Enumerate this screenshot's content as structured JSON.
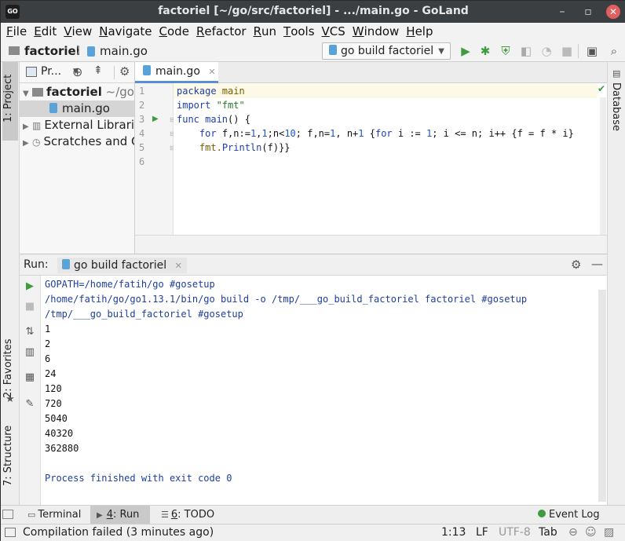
{
  "window": {
    "title": "factoriel [~/go/src/factoriel] - .../main.go - GoLand",
    "app_icon_text": "GO",
    "minimize_glyph": "–",
    "maximize_glyph": "▫",
    "close_glyph": "✕"
  },
  "menu": [
    {
      "mn": "F",
      "rest": "ile"
    },
    {
      "mn": "E",
      "rest": "dit"
    },
    {
      "mn": "V",
      "rest": "iew"
    },
    {
      "mn": "N",
      "rest": "avigate"
    },
    {
      "mn": "C",
      "rest": "ode"
    },
    {
      "mn": "R",
      "rest": "efactor"
    },
    {
      "mn": "R",
      "rest": "un"
    },
    {
      "mn": "T",
      "rest": "ools"
    },
    {
      "mn": "V",
      "rest": "CS"
    },
    {
      "mn": "W",
      "rest": "indow"
    },
    {
      "mn": "H",
      "rest": "elp"
    }
  ],
  "navbar": {
    "project": "factoriel",
    "file": "main.go",
    "run_config": "go build factoriel"
  },
  "left_stripe": {
    "project_tab": "1: Project",
    "favorites_tab": "2: Favorites",
    "structure_tab": "7: Structure"
  },
  "right_stripe": {
    "database_tab": "Database"
  },
  "project_panel": {
    "header_label": "Pr...",
    "root_name": "factoriel",
    "root_path": "~/go/src/factoriel",
    "file": "main.go",
    "external": "External Libraries",
    "scratches": "Scratches and Consoles"
  },
  "editor": {
    "tab_label": "main.go",
    "line_numbers": [
      "1",
      "2",
      "3",
      "4",
      "5",
      "6"
    ],
    "lines": [
      [
        {
          "t": "package ",
          "c": "kw"
        },
        {
          "t": "main",
          "c": "fn"
        }
      ],
      [
        {
          "t": "import ",
          "c": "kw"
        },
        {
          "t": "\"fmt\"",
          "c": "str"
        }
      ],
      [
        {
          "t": "func ",
          "c": "kw"
        },
        {
          "t": "main",
          "c": "kw"
        },
        {
          "t": "() {",
          "c": ""
        }
      ],
      [
        {
          "t": "    ",
          "c": ""
        },
        {
          "t": "for ",
          "c": "kw"
        },
        {
          "t": "f,n:=",
          "c": ""
        },
        {
          "t": "1",
          "c": "num"
        },
        {
          "t": ",",
          "c": ""
        },
        {
          "t": "1",
          "c": "num"
        },
        {
          "t": ";n<",
          "c": ""
        },
        {
          "t": "10",
          "c": "num"
        },
        {
          "t": "; f,n=",
          "c": ""
        },
        {
          "t": "1",
          "c": "num"
        },
        {
          "t": ", n+",
          "c": ""
        },
        {
          "t": "1",
          "c": "num"
        },
        {
          "t": " {",
          "c": ""
        },
        {
          "t": "for ",
          "c": "kw"
        },
        {
          "t": "i := ",
          "c": ""
        },
        {
          "t": "1",
          "c": "num"
        },
        {
          "t": "; i <= n; i++ {f = f * i}",
          "c": ""
        }
      ],
      [
        {
          "t": "    ",
          "c": ""
        },
        {
          "t": "fmt.",
          "c": "fn"
        },
        {
          "t": "Println",
          "c": "kw"
        },
        {
          "t": "(f)}}",
          "c": ""
        }
      ],
      []
    ]
  },
  "run_panel": {
    "label": "Run:",
    "tab": "go build factoriel",
    "output": [
      {
        "text": "GOPATH=/home/fatih/go #gosetup",
        "style": "blue"
      },
      {
        "text": "/home/fatih/go/go1.13.1/bin/go build -o /tmp/___go_build_factoriel factoriel #gosetup",
        "style": "blue"
      },
      {
        "text": "/tmp/___go_build_factoriel #gosetup",
        "style": "blue"
      },
      {
        "text": "1",
        "style": "blk"
      },
      {
        "text": "2",
        "style": "blk"
      },
      {
        "text": "6",
        "style": "blk"
      },
      {
        "text": "24",
        "style": "blk"
      },
      {
        "text": "120",
        "style": "blk"
      },
      {
        "text": "720",
        "style": "blk"
      },
      {
        "text": "5040",
        "style": "blk"
      },
      {
        "text": "40320",
        "style": "blk"
      },
      {
        "text": "362880",
        "style": "blk"
      },
      {
        "text": "",
        "style": "blk"
      },
      {
        "text": "Process finished with exit code 0",
        "style": "blue"
      }
    ]
  },
  "bottom_tabs": {
    "terminal": "Terminal",
    "run_num": "4",
    "run_label": ": Run",
    "todo_num": "6",
    "todo_label": ": TODO",
    "event_log": "Event Log"
  },
  "status": {
    "message": "Compilation failed (3 minutes ago)",
    "position": "1:13",
    "line_sep": "LF",
    "encoding": "UTF-8",
    "indent": "Tab"
  },
  "colors": {
    "run_green": "#3e9b3e",
    "console_blue": "#1d3e9b",
    "keyword_blue": "#1f3fa8",
    "string_green": "#2a7a2a"
  }
}
